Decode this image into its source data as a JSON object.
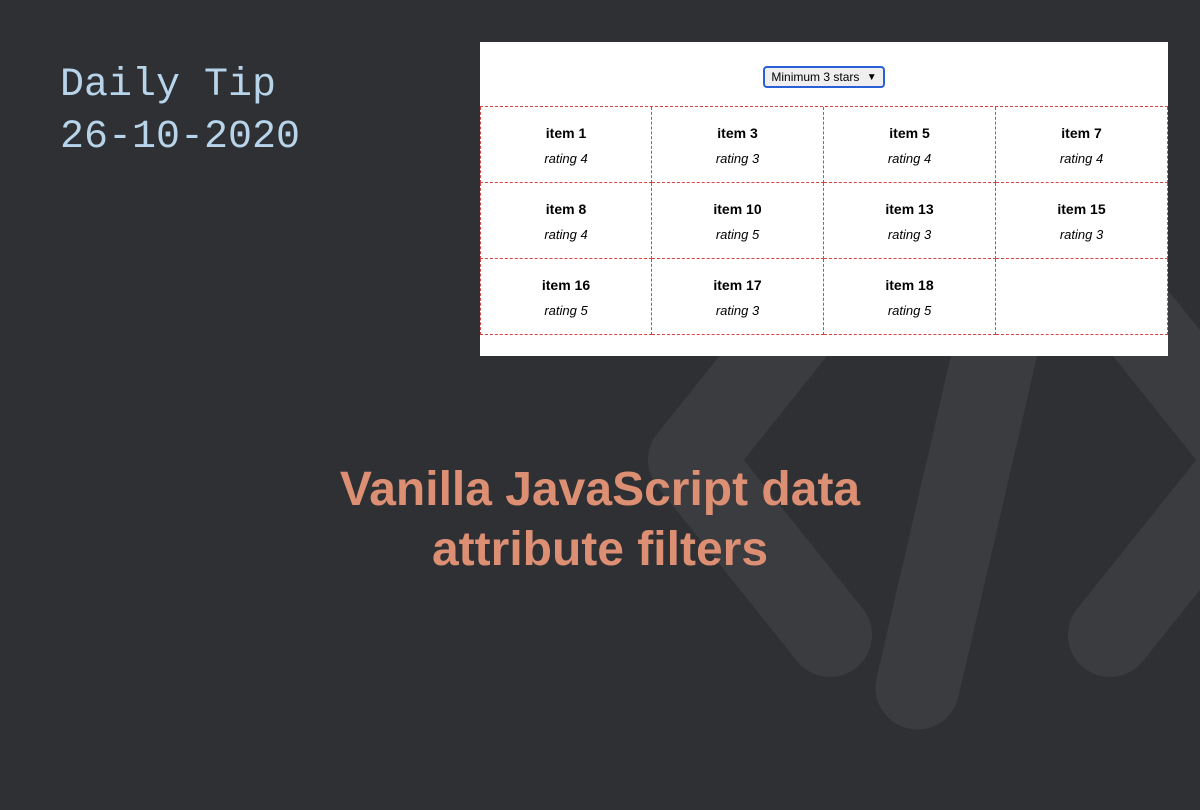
{
  "header": {
    "line1": "Daily Tip",
    "line2": "26-10-2020"
  },
  "title": {
    "line1": "Vanilla JavaScript data",
    "line2": "attribute filters"
  },
  "demo": {
    "select_value": "Minimum 3 stars",
    "items": [
      {
        "name": "item 1",
        "rating": "rating 4"
      },
      {
        "name": "item 3",
        "rating": "rating 3"
      },
      {
        "name": "item 5",
        "rating": "rating 4"
      },
      {
        "name": "item 7",
        "rating": "rating 4"
      },
      {
        "name": "item 8",
        "rating": "rating 4"
      },
      {
        "name": "item 10",
        "rating": "rating 5"
      },
      {
        "name": "item 13",
        "rating": "rating 3"
      },
      {
        "name": "item 15",
        "rating": "rating 3"
      },
      {
        "name": "item 16",
        "rating": "rating 5"
      },
      {
        "name": "item 17",
        "rating": "rating 3"
      },
      {
        "name": "item 18",
        "rating": "rating 5"
      }
    ]
  }
}
